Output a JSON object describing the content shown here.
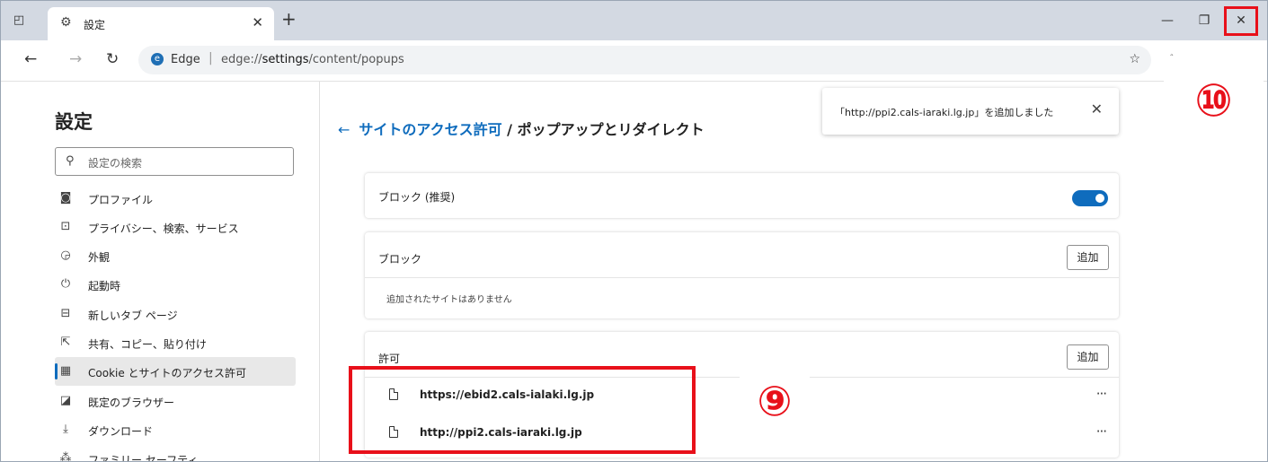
{
  "browser": {
    "tab_title": "設定",
    "tab_icon": "gear-icon",
    "new_tab_label": "+",
    "address_brand": "Edge",
    "address_url_prefix": "edge://",
    "address_url_host": "settings",
    "address_url_path": "/content/popups"
  },
  "sidebar": {
    "title": "設定",
    "search_placeholder": "設定の検索",
    "items": [
      {
        "icon": "profile-icon",
        "glyph": "◙",
        "label": "プロファイル"
      },
      {
        "icon": "lock-icon",
        "glyph": "⊡",
        "label": "プライバシー、検索、サービス"
      },
      {
        "icon": "appearance-icon",
        "glyph": "◶",
        "label": "外観"
      },
      {
        "icon": "power-icon",
        "glyph": "⏻",
        "label": "起動時"
      },
      {
        "icon": "new-tab-icon",
        "glyph": "⊟",
        "label": "新しいタブ ページ"
      },
      {
        "icon": "share-icon",
        "glyph": "⇱",
        "label": "共有、コピー、貼り付け"
      },
      {
        "icon": "cookie-icon",
        "glyph": "▦",
        "label": "Cookie とサイトのアクセス許可",
        "active": true
      },
      {
        "icon": "default-browser-icon",
        "glyph": "◪",
        "label": "既定のブラウザー"
      },
      {
        "icon": "download-icon",
        "glyph": "⤓",
        "label": "ダウンロード"
      },
      {
        "icon": "family-icon",
        "glyph": "⁂",
        "label": "ファミリー セーフティ"
      }
    ]
  },
  "main": {
    "breadcrumb_link": "サイトのアクセス許可",
    "breadcrumb_sep": " / ",
    "breadcrumb_current": "ポップアップとリダイレクト",
    "toast": "「http://ppi2.cals-iaraki.lg.jp」を追加しました",
    "block_recommended_label": "ブロック (推奨)",
    "block_recommended_on": true,
    "block_section_title": "ブロック",
    "block_add_label": "追加",
    "block_empty_text": "追加されたサイトはありません",
    "allow_section_title": "許可",
    "allow_add_label": "追加",
    "allow_sites": [
      {
        "url": "https://ebid2.cals-ialaki.lg.jp",
        "more": "···"
      },
      {
        "url": "http://ppi2.cals-iaraki.lg.jp",
        "more": "···"
      }
    ]
  },
  "annotations": {
    "label_9": "⑨",
    "label_10": "⑩",
    "color": "#e8101a"
  },
  "colors": {
    "accent": "#0f6cbd",
    "tabstrip": "#d3d9e2"
  }
}
